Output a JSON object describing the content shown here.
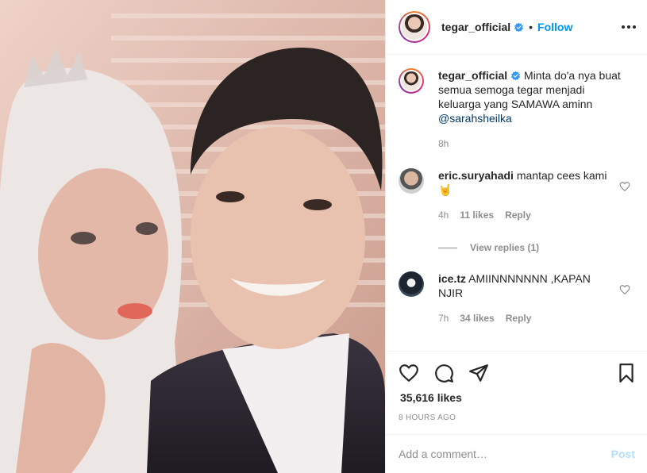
{
  "header": {
    "username": "tegar_official",
    "separator": "•",
    "follow_label": "Follow"
  },
  "caption": {
    "username": "tegar_official",
    "text": "Minta do'a nya buat semua semoga tegar menjadi keluarga yang SAMAWA aminn",
    "mention": "@sarahsheilka",
    "time": "8h"
  },
  "comments": [
    {
      "username": "eric.suryahadi",
      "text": "mantap cees kami 🤘",
      "time": "4h",
      "likes": "11 likes",
      "reply_label": "Reply"
    },
    {
      "username": "ice.tz",
      "text": "AMIINNNNNNN ,KAPAN NJIR",
      "time": "7h",
      "likes": "34 likes",
      "reply_label": "Reply"
    }
  ],
  "view_replies_label": "View replies (1)",
  "likes_count": "35,616 likes",
  "posted_ago": "8 HOURS AGO",
  "add_comment": {
    "placeholder": "Add a comment…",
    "post_label": "Post"
  },
  "colors": {
    "accent": "#0095f6",
    "muted": "#8e8e8e",
    "post_disabled": "#b2dffc",
    "mention": "#00376b"
  },
  "icons": [
    "verified-badge-icon",
    "more-options-icon",
    "heart-icon",
    "comment-icon",
    "share-icon",
    "bookmark-icon"
  ]
}
